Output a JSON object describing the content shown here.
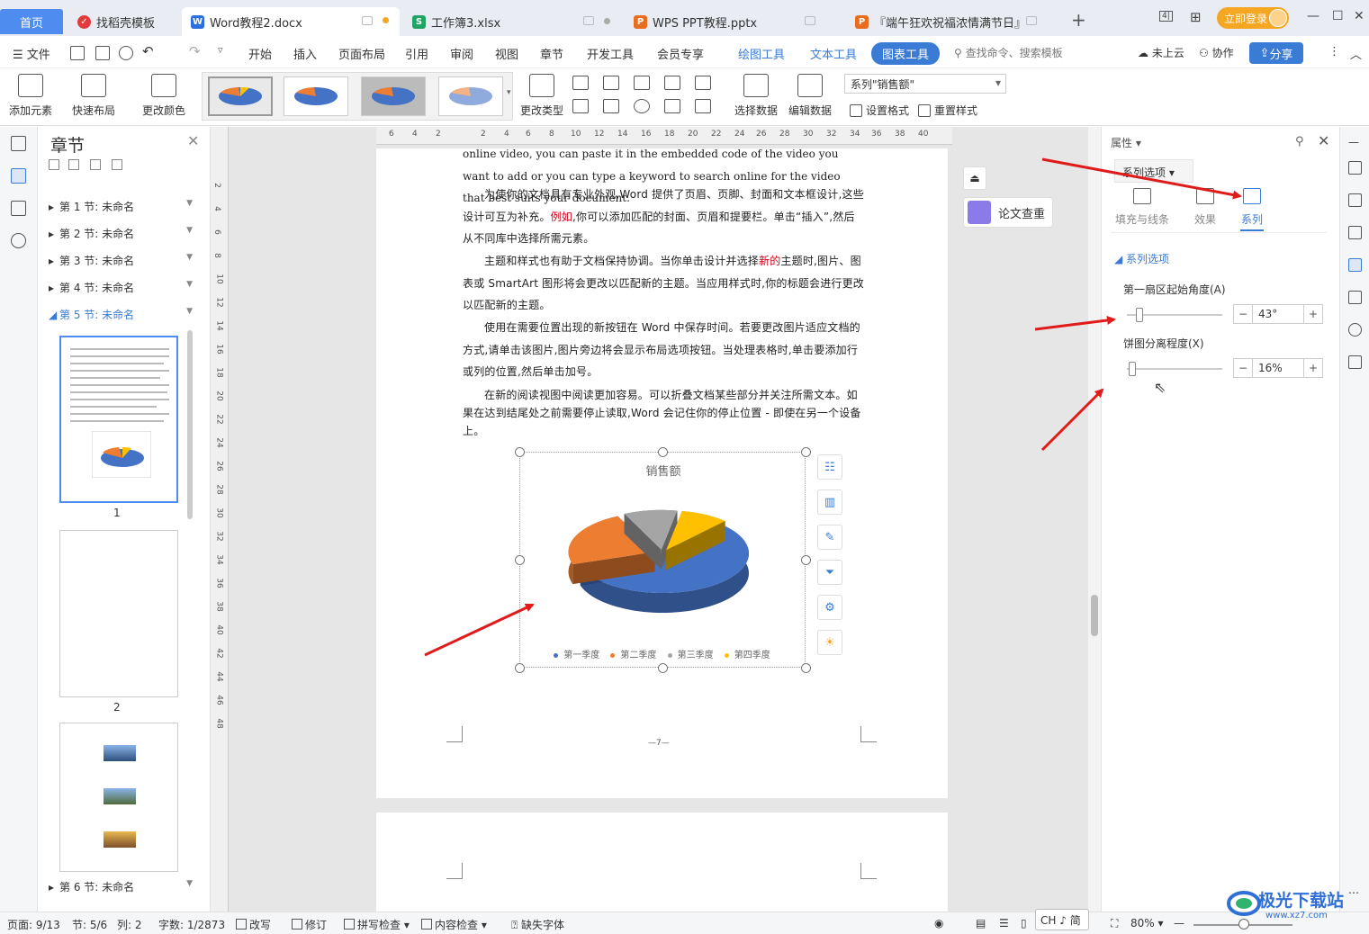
{
  "tabs": [
    {
      "label": "首页"
    },
    {
      "label": "找稻壳模板"
    },
    {
      "label": "Word教程2.docx"
    },
    {
      "label": "工作簿3.xlsx"
    },
    {
      "label": "WPS PPT教程.pptx"
    },
    {
      "label": "『端午狂欢祝福浓情满节日』"
    }
  ],
  "titlebar": {
    "login": "立即登录",
    "new_tab": "+"
  },
  "menu": {
    "file": "文件",
    "items": [
      "开始",
      "插入",
      "页面布局",
      "引用",
      "审阅",
      "视图",
      "章节",
      "开发工具",
      "会员专享"
    ],
    "context_tabs": [
      "绘图工具",
      "文本工具",
      "图表工具"
    ],
    "search": "查找命令、搜索模板",
    "cloud": "未上云",
    "collab": "协作",
    "share": "分享"
  },
  "ribbon": {
    "add_element": "添加元素",
    "quick_layout": "快速布局",
    "change_color": "更改颜色",
    "change_type": "更改类型",
    "select_data": "选择数据",
    "edit_data": "编辑数据",
    "series_select": "系列\"销售额\"",
    "set_format": "设置格式",
    "reset_style": "重置样式"
  },
  "chapter_panel": {
    "title": "章节",
    "chapters": [
      "第 1 节: 未命名",
      "第 2 节: 未命名",
      "第 3 节: 未命名",
      "第 4 节: 未命名",
      "第 5 节: 未命名",
      "第 6 节: 未命名"
    ],
    "page_numbers": [
      "1",
      "2"
    ]
  },
  "document": {
    "para1": "online video, you can paste it in the embedded code of the video you want to add or you can type a keyword to search online for the video that best suits your document.",
    "para2_a": "为使你的文档具有专业外观,Word 提供了页眉、页脚、封面和文本框设计,这些设计可互为补充。",
    "para2_red": "例如",
    "para2_b": ",你可以添加匹配的封面、页眉和提要栏。单击“插入”,然后从不同库中选择所需元素。",
    "para3_a": "主题和样式也有助于文档保持协调。当你单击设计并选择",
    "para3_red": "新的",
    "para3_b": "主题时,图片、图表或 SmartArt 图形将会更改以匹配新的主题。当应用样式时,你的标题会进行更改以匹配新的主题。",
    "para4": "使用在需要位置出现的新按钮在 Word 中保存时间。若要更改图片适应文档的方式,请单击该图片,图片旁边将会显示布局选项按钮。当处理表格时,单击要添加行或列的位置,然后单击加号。",
    "para5": "在新的阅读视图中阅读更加容易。可以折叠文档某些部分并关注所需文本。如果在达到结尾处之前需要停止读取,Word 会记住你的停止位置 - 即使在另一个设备上。",
    "page_number": "—7—",
    "paper_check": "论文查重"
  },
  "chart_data": {
    "type": "pie",
    "title": "销售额",
    "categories": [
      "第一季度",
      "第二季度",
      "第三季度",
      "第四季度"
    ],
    "values": [
      58,
      23,
      10,
      9
    ],
    "colors": [
      "#4472c4",
      "#ed7d31",
      "#a5a5a5",
      "#ffc000"
    ],
    "legend": "bottom",
    "first_slice_angle": 43,
    "explosion": 16
  },
  "properties": {
    "title": "属性",
    "dropdown": "系列选项",
    "tabs": [
      "填充与线条",
      "效果",
      "系列"
    ],
    "section": "系列选项",
    "angle_label": "第一扇区起始角度(A)",
    "angle_value": "43°",
    "explode_label": "饼图分离程度(X)",
    "explode_value": "16%"
  },
  "status": {
    "page": "页面: 9/13",
    "section": "节: 5/6",
    "column": "列: 2",
    "words": "字数: 1/2873",
    "revise": "改写",
    "track": "修订",
    "spell": "拼写检查",
    "content": "内容检查",
    "missing_font": "缺失字体",
    "ime": "CH ♪ 简",
    "zoom": "80%"
  },
  "watermark": {
    "text": "极光下载站",
    "url": "www.xz7.com"
  }
}
